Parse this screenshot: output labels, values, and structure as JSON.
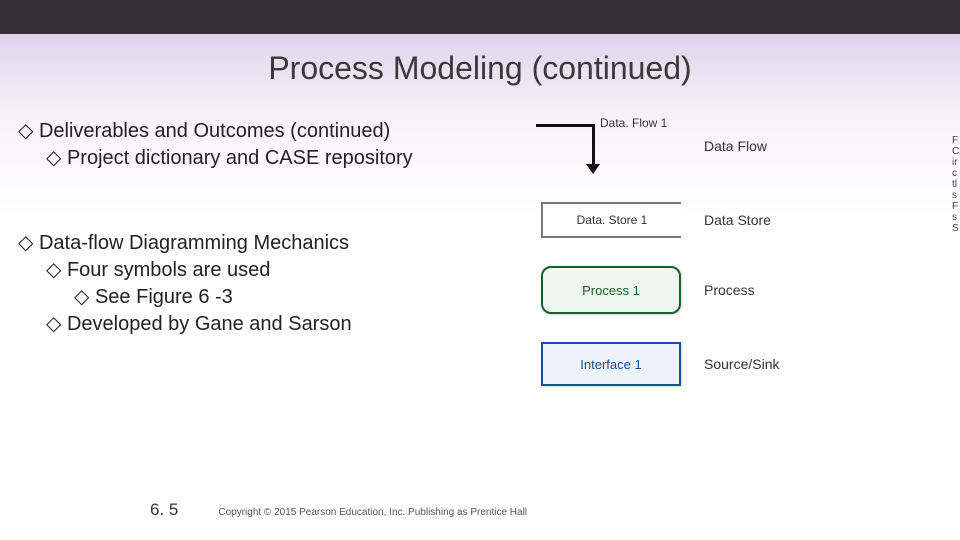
{
  "title": "Process Modeling (continued)",
  "bullets": {
    "b0": "Deliverables and Outcomes (continued)",
    "b1": "Project dictionary and CASE repository",
    "b2": "Data-flow Diagramming Mechanics",
    "b3": "Four symbols are used",
    "b4": "See Figure 6 -3",
    "b5": "Developed by Gane and Sarson"
  },
  "figure": {
    "dataflow": {
      "symbol_text": "Data. Flow 1",
      "label": "Data Flow"
    },
    "datastore": {
      "symbol_text": "Data. Store 1",
      "label": "Data Store"
    },
    "process": {
      "symbol_text": "Process 1",
      "label": "Process"
    },
    "interface": {
      "symbol_text": "Interface 1",
      "label": "Source/Sink"
    }
  },
  "side_cut": "F C ir c tl s F s S",
  "footer": {
    "pagenum": "6. 5",
    "copyright": "Copyright © 2015 Pearson Education, Inc. Publishing as Prentice Hall"
  },
  "bullet_glyph": "◇"
}
